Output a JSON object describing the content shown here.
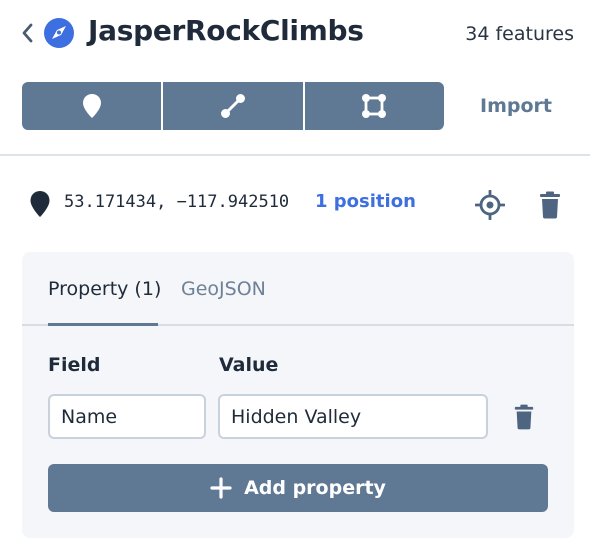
{
  "header": {
    "back_icon": "chevron-left-icon",
    "logo_icon": "app-logo-icon",
    "title": "JasperRockClimbs",
    "feature_count": "34 features"
  },
  "toolbar": {
    "tools": [
      {
        "icon": "point-marker-icon"
      },
      {
        "icon": "line-path-icon"
      },
      {
        "icon": "polygon-icon"
      }
    ],
    "import_label": "Import"
  },
  "feature": {
    "icon": "map-pin-icon",
    "coordinates": "53.171434, −117.942510",
    "position_count": "1 position",
    "locate_icon": "crosshair-icon",
    "delete_icon": "trash-icon"
  },
  "panel": {
    "tabs": [
      {
        "label": "Property (1)",
        "active": true
      },
      {
        "label": "GeoJSON",
        "active": false
      }
    ],
    "columns": {
      "field": "Field",
      "value": "Value"
    },
    "properties": [
      {
        "field": "Name",
        "value": "Hidden Valley"
      }
    ],
    "add_property_label": "Add property"
  },
  "colors": {
    "accent": "#5f7894",
    "link": "#3d6fe0",
    "text": "#1f2b3a",
    "panel_bg": "#f4f6f9"
  }
}
